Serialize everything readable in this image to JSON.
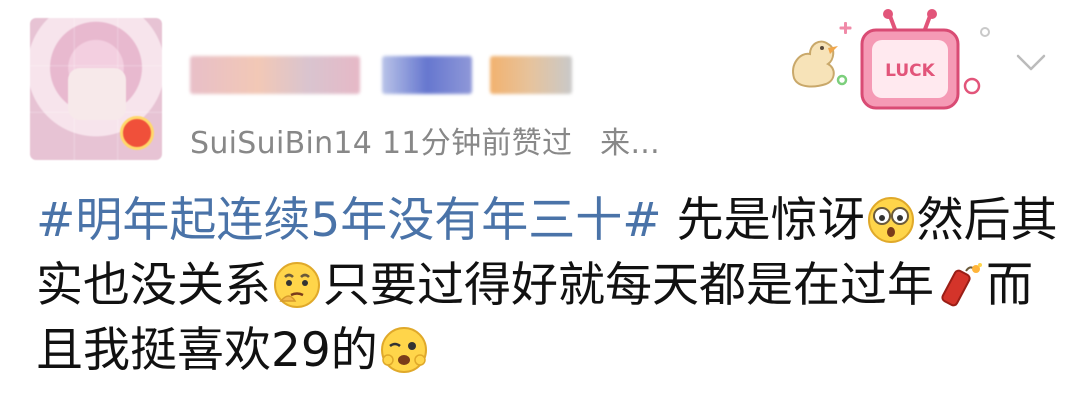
{
  "user": {
    "avatar_icon": "user-avatar-blurred",
    "name_obscured": true,
    "handle": "SuiSuiBin14",
    "time_liked": "11分钟前赞过",
    "source_truncated": "来..."
  },
  "header_decoration": {
    "badge_text": "LUCK",
    "badge_icon": "luck-tv-sticker-icon",
    "duck_icon": "duck-sticker-icon",
    "menu_icon": "chevron-down-icon"
  },
  "post": {
    "hashtag": "#明年起连续5年没有年三十#",
    "line1_after_hashtag": "先是惊讶",
    "line1_end": "然后其",
    "line2_part1": "实也没关系",
    "line2_part2": "只要过得好就每天都是在过年",
    "line2_end": "而",
    "line3_part1": "且我挺喜欢29的",
    "emojis": [
      "surprised-emoji-icon",
      "thinking-emoji-icon",
      "firecracker-icon",
      "wink-emoji-icon"
    ]
  },
  "colors": {
    "hashtag": "#4a73a8",
    "meta_text": "#888888",
    "body_text": "#111111",
    "luck_pink": "#f59ab5"
  }
}
